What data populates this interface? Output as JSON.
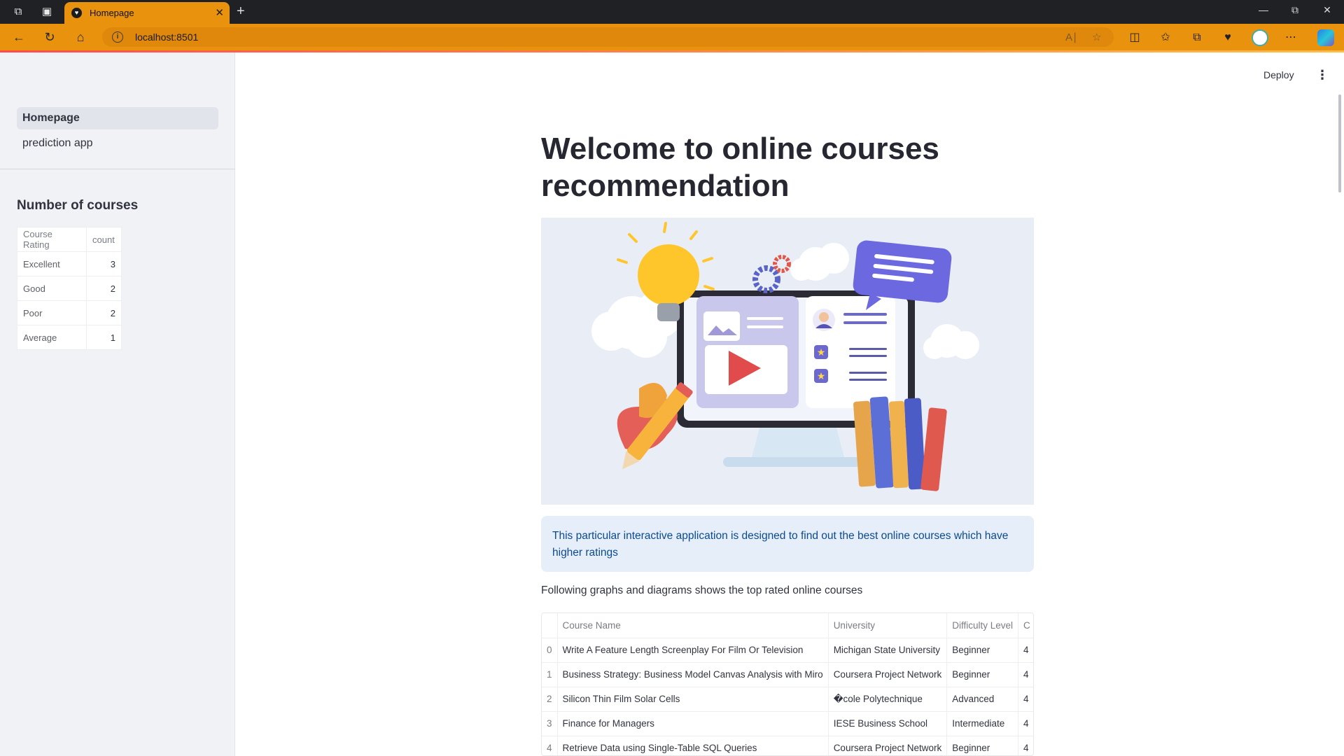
{
  "browser": {
    "tab_title": "Homepage",
    "url": "localhost:8501",
    "colors": {
      "chrome_accent": "#e8920e",
      "titlebar": "#202124"
    }
  },
  "header": {
    "deploy_label": "Deploy"
  },
  "sidebar": {
    "nav": [
      {
        "label": "Homepage",
        "active": true
      },
      {
        "label": "prediction app",
        "active": false
      }
    ],
    "section_title": "Number of courses",
    "table": {
      "columns": [
        "Course Rating",
        "count"
      ],
      "rows": [
        [
          "Excellent",
          "3"
        ],
        [
          "Good",
          "2"
        ],
        [
          "Poor",
          "2"
        ],
        [
          "Average",
          "1"
        ]
      ]
    }
  },
  "main": {
    "title": "Welcome to online courses recommendation",
    "info_text": "This particular interactive application is designed to find out the best online courses which have higher ratings",
    "lead_text": "Following graphs and diagrams shows the top rated online courses",
    "dataframe": {
      "columns": [
        "",
        "Course Name",
        "University",
        "Difficulty Level",
        "C"
      ],
      "rows": [
        [
          "0",
          "Write A Feature Length Screenplay For Film Or Television",
          "Michigan State University",
          "Beginner",
          "4"
        ],
        [
          "1",
          "Business Strategy: Business Model Canvas Analysis with Miro",
          "Coursera Project Network",
          "Beginner",
          "4"
        ],
        [
          "2",
          "Silicon Thin Film Solar Cells",
          "�cole Polytechnique",
          "Advanced",
          "4"
        ],
        [
          "3",
          "Finance for Managers",
          "IESE Business School",
          "Intermediate",
          "4"
        ],
        [
          "4",
          "Retrieve Data using Single-Table SQL Queries",
          "Coursera Project Network",
          "Beginner",
          "4"
        ]
      ]
    }
  }
}
